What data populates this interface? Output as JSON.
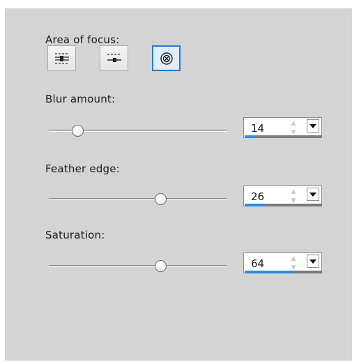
{
  "focus": {
    "label": "Area of focus:",
    "buttons": [
      {
        "icon": "horizontal-band-icon",
        "selected": false
      },
      {
        "icon": "horizontal-line-icon",
        "selected": false
      },
      {
        "icon": "circle-focus-icon",
        "selected": true
      }
    ]
  },
  "blur": {
    "label": "Blur amount:",
    "value": "14",
    "slider_fraction": 0.14
  },
  "feather": {
    "label": "Feather edge:",
    "value": "26",
    "slider_fraction": 0.64
  },
  "saturation": {
    "label": "Saturation:",
    "value": "64",
    "slider_fraction": 0.64
  },
  "colors": {
    "panel": "#d4d4d4",
    "accent": "#2f8ae0",
    "selected_border": "#2a78cf"
  }
}
